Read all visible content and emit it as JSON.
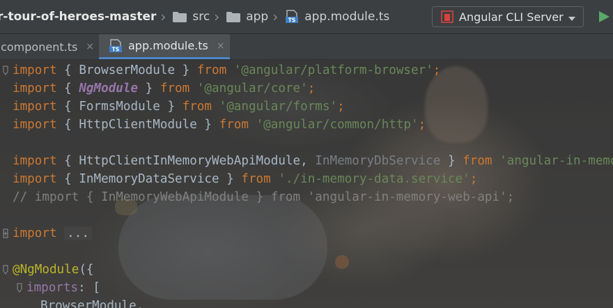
{
  "breadcrumb": {
    "project": "r-tour-of-heroes-master",
    "folder1": "src",
    "folder2": "app",
    "file": "app.module.ts"
  },
  "run_config": {
    "label": "Angular CLI Server"
  },
  "tabs": [
    {
      "label": ".component.ts",
      "close": "×"
    },
    {
      "label": "app.module.ts",
      "close": "×"
    }
  ],
  "icons": {
    "ts_badge": "TS"
  },
  "code": {
    "l1": {
      "kw": "import",
      "a": " { BrowserModule } ",
      "from": "from",
      "str": " '@angular/platform-browser'",
      "end": ";"
    },
    "l2": {
      "kw": "import",
      "a": " { ",
      "ng": "NgModule",
      "b": " } ",
      "from": "from",
      "str": " '@angular/core'",
      "end": ";"
    },
    "l3": {
      "kw": "import",
      "a": " { FormsModule } ",
      "from": "from",
      "str": " '@angular/forms'",
      "end": ";"
    },
    "l4": {
      "kw": "import",
      "a": " { HttpClientModule } ",
      "from": "from",
      "str": " '@angular/common/http'",
      "end": ";"
    },
    "l6": {
      "kw": "import",
      "a": " { HttpClientInMemoryWebApiModule, ",
      "dim": "InMemoryDbService",
      "b": " } ",
      "from": "from",
      "str": " 'angular-in-memo"
    },
    "l7": {
      "kw": "import",
      "a": " { InMemoryDataService } ",
      "from": "from",
      "str": " './in-memory-data.service'",
      "end": ";"
    },
    "l8": {
      "comment": "// import { InMemoryWebApiModule } from 'angular-in-memory-web-api';"
    },
    "l10": {
      "kw": "import",
      "dots": "..."
    },
    "l12": {
      "deco": "@NgModule",
      "rest": "({"
    },
    "l13": {
      "key": "imports",
      "rest": ": ["
    },
    "l14": {
      "text": "BrowserModule,"
    }
  },
  "colors": {
    "keyword": "#cc7832",
    "string": "#6a8759",
    "decorator": "#bbb529",
    "ng_symbol": "#9876aa",
    "comment": "#808080",
    "accent_tab": "#4a88c7",
    "run_green": "#59a869",
    "ts_badge_blue": "#3f7ec5"
  }
}
